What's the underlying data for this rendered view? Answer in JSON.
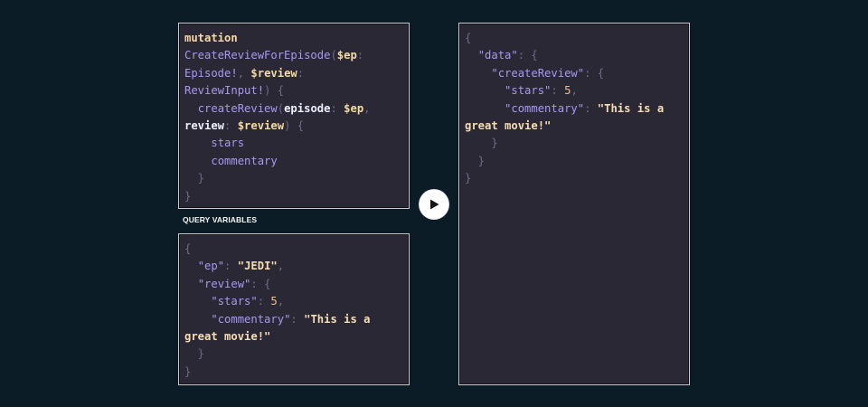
{
  "query": {
    "keyword": "mutation",
    "operation_name": "CreateReviewForEpisode",
    "variable_ep": "$ep",
    "type_episode": "Episode!",
    "variable_review": "$review",
    "type_review_input": "ReviewInput!",
    "field_name": "createReview",
    "arg_episode": "episode",
    "arg_review": "review",
    "selection_stars": "stars",
    "selection_commentary": "commentary"
  },
  "variables_label": "QUERY VARIABLES",
  "variables": {
    "key_ep": "\"ep\"",
    "value_ep": "\"JEDI\"",
    "key_review": "\"review\"",
    "key_stars": "\"stars\"",
    "value_stars": "5",
    "key_commentary": "\"commentary\"",
    "value_commentary_line1": "\"This is a",
    "value_commentary_line2": "great movie!\""
  },
  "result": {
    "key_data": "\"data\"",
    "key_create_review": "\"createReview\"",
    "key_stars": "\"stars\"",
    "value_stars": "5",
    "key_commentary": "\"commentary\"",
    "value_commentary_line1": "\"This is a",
    "value_commentary_line2": "great movie!\""
  },
  "icons": {
    "run": "play-icon"
  },
  "colors": {
    "background": "#0c1c26",
    "panel": "#2b2836",
    "keyword": "#f6d8a7",
    "name": "#a898f0",
    "string": "#f7deb2",
    "number": "#f1c085",
    "punctuation": "#6f6a86"
  }
}
